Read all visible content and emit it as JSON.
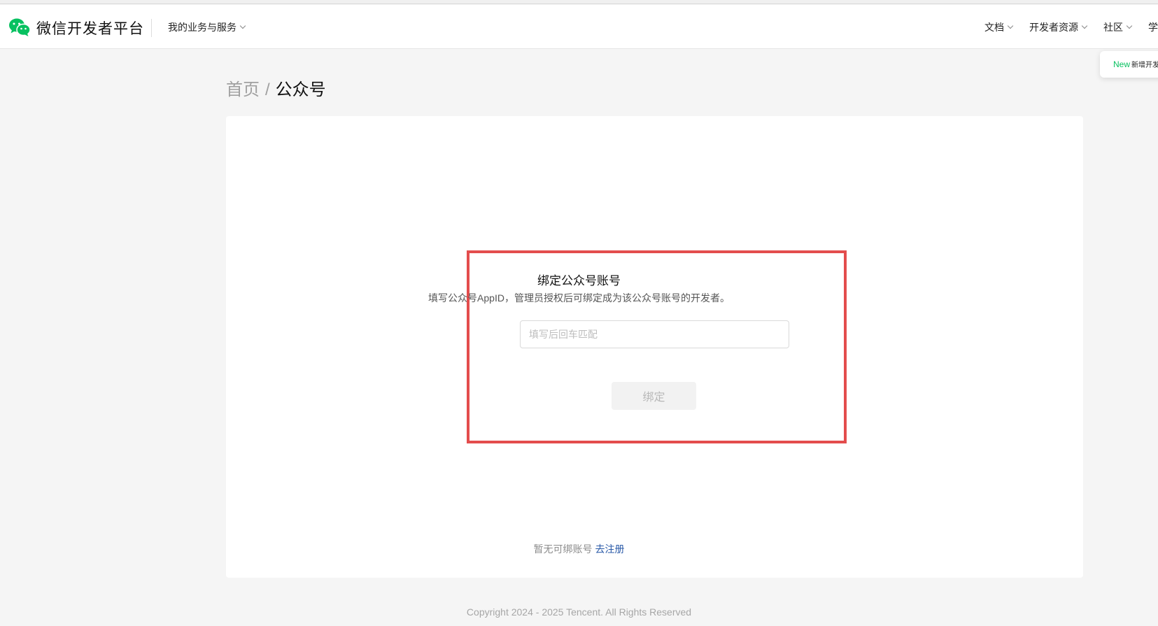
{
  "brand": {
    "name": "微信开发者平台",
    "icon": "wechat-logo-icon",
    "color": "#07c160"
  },
  "nav": {
    "business_menu": "我的业务与服务",
    "right": [
      {
        "key": "docs",
        "label": "文档"
      },
      {
        "key": "resources",
        "label": "开发者资源"
      },
      {
        "key": "community",
        "label": "社区"
      },
      {
        "key": "learn",
        "label": "学"
      }
    ]
  },
  "notice": {
    "badge": "New",
    "text": "新增开发"
  },
  "breadcrumb": {
    "home": "首页",
    "separator": "/",
    "current": "公众号"
  },
  "bind": {
    "title": "绑定公众号账号",
    "description": "填写公众号AppID，管理员授权后可绑定成为该公众号账号的开发者。",
    "input_placeholder": "填写后回车匹配",
    "input_value": "",
    "button_label": "绑定",
    "button_disabled": true
  },
  "empty": {
    "text": "暂无可绑账号",
    "link_label": "去注册"
  },
  "footer": {
    "copyright": "Copyright 2024 - 2025 Tencent. All Rights Reserved"
  },
  "colors": {
    "highlight_border": "#e34d4d",
    "link": "#2a5aa8",
    "accent": "#07c160"
  }
}
